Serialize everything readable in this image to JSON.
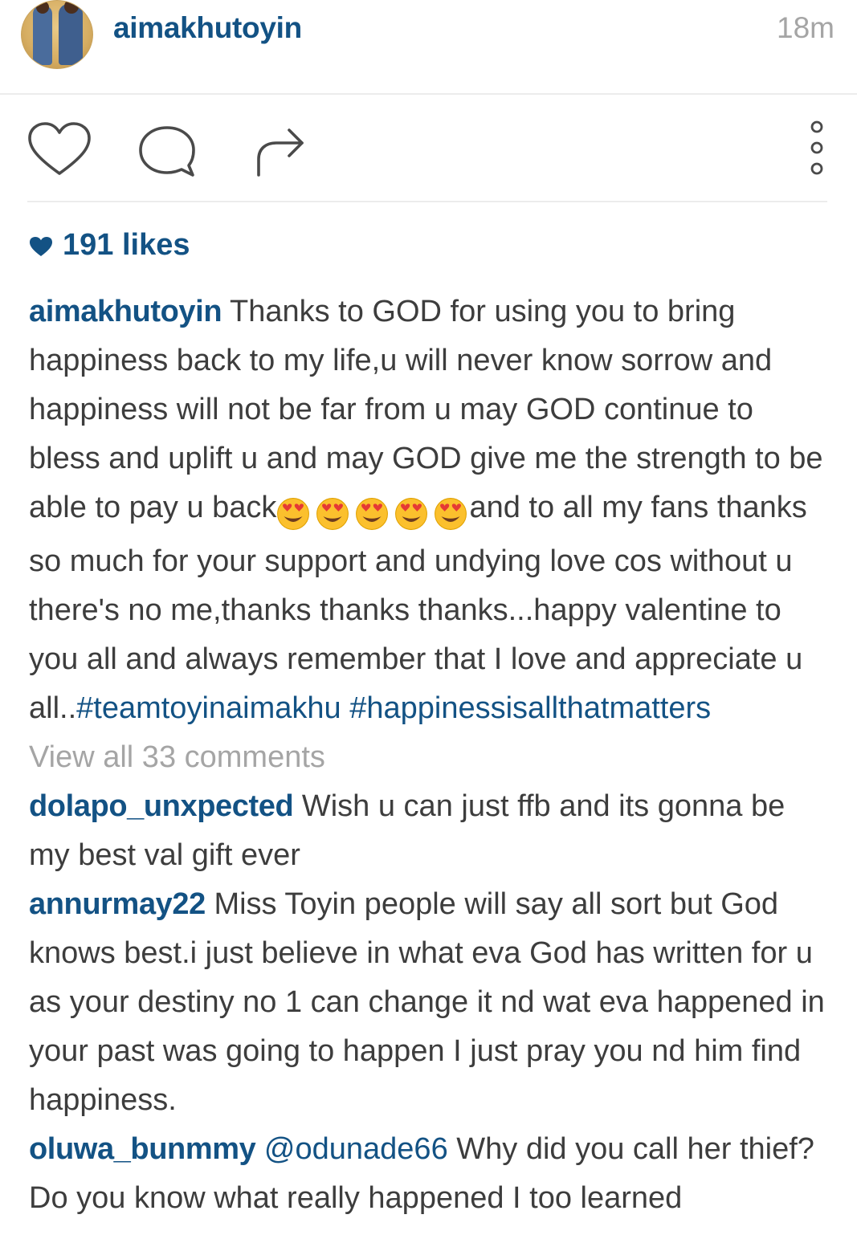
{
  "header": {
    "username": "aimakhutoyin",
    "time": "18m",
    "avatar_icon": "profile-photo"
  },
  "actions": {
    "like_icon": "heart-outline-icon",
    "comment_icon": "speech-bubble-icon",
    "share_icon": "share-arrow-icon",
    "more_icon": "vertical-dots-icon"
  },
  "likes": {
    "text": "191 likes"
  },
  "caption": {
    "username": "aimakhutoyin",
    "text_before_emojis": " Thanks to GOD for using you to bring happiness back to my life,u will never know sorrow and happiness will not be far from u may GOD continue to bless and uplift u and may GOD give me the strength to be able to pay u back",
    "emoji_count": 5,
    "emoji_icon": "heart-eyes-emoji",
    "text_after_emojis": "and to all my fans thanks so much for your support and undying love cos without u there's no me,thanks thanks thanks...happy valentine to you all and always remember that I love and appreciate u all..",
    "hashtag1": "#teamtoyinaimakhu",
    "hashtag2": "#happinessisallthatmatters"
  },
  "view_all_comments": "View all 33 comments",
  "comments": [
    {
      "username": "dolapo_unxpected",
      "text": " Wish u can just ffb and its gonna be my best val gift ever"
    },
    {
      "username": "annurmay22",
      "text": " Miss Toyin people will say all sort but God knows best.i just believe in what eva God has written for u as your destiny no 1 can change it nd wat eva happened in your past was going to happen I just pray you nd him find happiness."
    },
    {
      "username": "oluwa_bunmmy",
      "mention": "@odunade66",
      "text": "  Why did you call her thief? Do you know what really happened I too learned"
    }
  ],
  "colors": {
    "link_blue": "#135284",
    "body_text": "#3d3d3d",
    "muted_gray": "#a5a5a5",
    "divider": "#ececec"
  }
}
